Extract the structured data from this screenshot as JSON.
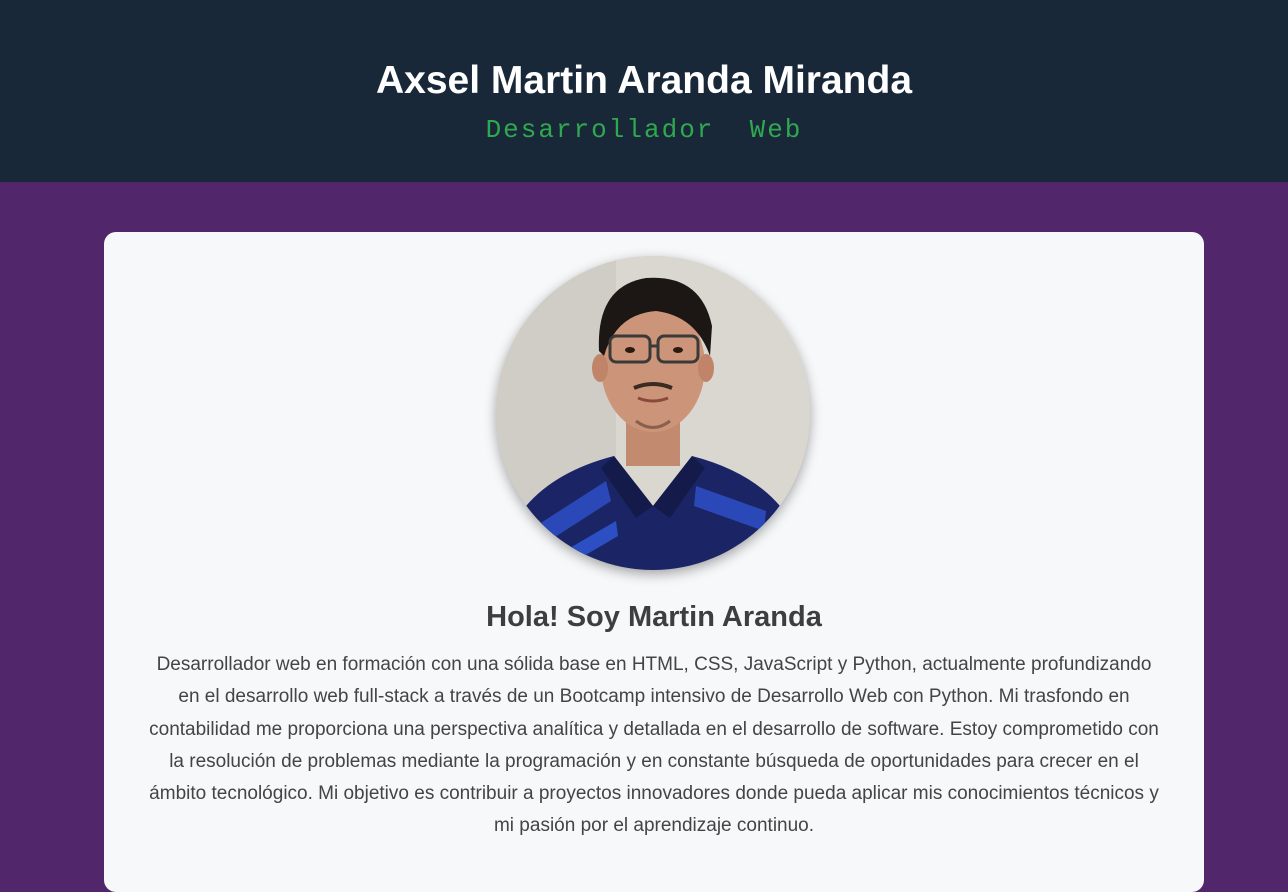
{
  "header": {
    "title": "Axsel Martin Aranda Miranda",
    "subtitle": "Desarrollador  Web"
  },
  "profile": {
    "photo_icon": "profile-photo",
    "greeting": "Hola! Soy Martin Aranda",
    "bio": "Desarrollador web en formación con una sólida base en HTML, CSS, JavaScript y Python, actualmente profundizando en el desarrollo web full-stack a través de un Bootcamp intensivo de Desarrollo Web con Python. Mi trasfondo en contabilidad me proporciona una perspectiva analítica y detallada en el desarrollo de software. Estoy comprometido con la resolución de problemas mediante la programación y en constante búsqueda de oportunidades para crecer en el ámbito tecnológico. Mi objetivo es contribuir a proyectos innovadores donde pueda aplicar mis conocimientos técnicos y mi pasión por el aprendizaje continuo."
  },
  "colors": {
    "header_bg": "#192838",
    "page_bg": "#52266b",
    "card_bg": "#f7f8fa",
    "accent_green": "#2fa84f"
  }
}
